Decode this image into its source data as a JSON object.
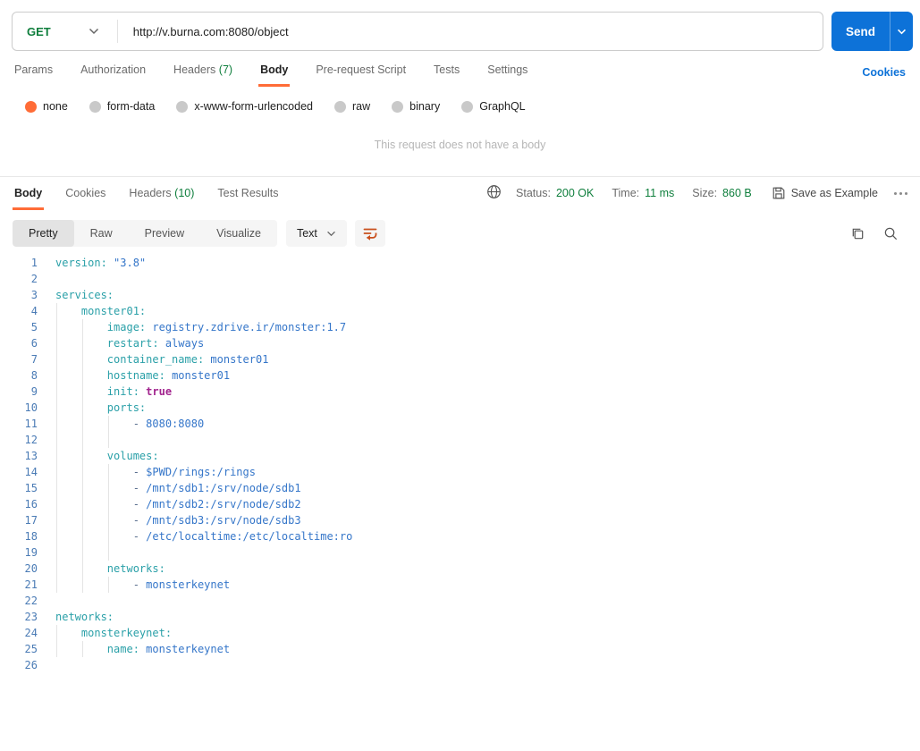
{
  "colors": {
    "orange": "#ff6c37",
    "green": "#0e7e3c",
    "blue": "#0d72d8",
    "key": "#2aa0a8",
    "val": "#3576c9",
    "dash": "#5a6f8f",
    "bool": "#a2248e",
    "lnum": "#4a7bb5",
    "guide": "#e4e4e4",
    "graytext": "#6b6b6b",
    "darktext": "#212121",
    "muted": "#b6b6b6"
  },
  "request_bar": {
    "method": "GET",
    "url": "http://v.burna.com:8080/object",
    "send_label": "Send"
  },
  "request_tabs": {
    "items": [
      {
        "label": "Params"
      },
      {
        "label": "Authorization"
      },
      {
        "label": "Headers",
        "count": "(7)"
      },
      {
        "label": "Body",
        "active": true
      },
      {
        "label": "Pre-request Script"
      },
      {
        "label": "Tests"
      },
      {
        "label": "Settings"
      }
    ],
    "cookies_link": "Cookies"
  },
  "body_modes": {
    "options": [
      "none",
      "form-data",
      "x-www-form-urlencoded",
      "raw",
      "binary",
      "GraphQL"
    ],
    "selected": "none",
    "empty_message": "This request does not have a body"
  },
  "response": {
    "tabs": [
      {
        "label": "Body",
        "active": true
      },
      {
        "label": "Cookies"
      },
      {
        "label": "Headers",
        "count": "(10)"
      },
      {
        "label": "Test Results"
      }
    ],
    "meta": {
      "status_label": "Status:",
      "status_value": "200 OK",
      "time_label": "Time:",
      "time_value": "11 ms",
      "size_label": "Size:",
      "size_value": "860 B",
      "save_as_example": "Save as Example"
    },
    "view_tabs": {
      "options": [
        "Pretty",
        "Raw",
        "Preview",
        "Visualize"
      ],
      "selected": "Pretty",
      "format": "Text"
    }
  },
  "code": {
    "lines": [
      {
        "n": 1,
        "g": [],
        "seg": [
          [
            "k",
            "version:"
          ],
          [
            "p",
            " "
          ],
          [
            "v",
            "\"3.8\""
          ]
        ]
      },
      {
        "n": 2,
        "g": [],
        "seg": []
      },
      {
        "n": 3,
        "g": [],
        "seg": [
          [
            "k",
            "services:"
          ]
        ]
      },
      {
        "n": 4,
        "g": [
          0
        ],
        "seg": [
          [
            "p",
            "    "
          ],
          [
            "k",
            "monster01:"
          ]
        ]
      },
      {
        "n": 5,
        "g": [
          0,
          4
        ],
        "seg": [
          [
            "p",
            "        "
          ],
          [
            "k",
            "image:"
          ],
          [
            "p",
            " "
          ],
          [
            "v",
            "registry.zdrive.ir/monster:1.7"
          ]
        ]
      },
      {
        "n": 6,
        "g": [
          0,
          4
        ],
        "seg": [
          [
            "p",
            "        "
          ],
          [
            "k",
            "restart:"
          ],
          [
            "p",
            " "
          ],
          [
            "v",
            "always"
          ]
        ]
      },
      {
        "n": 7,
        "g": [
          0,
          4
        ],
        "seg": [
          [
            "p",
            "        "
          ],
          [
            "k",
            "container_name:"
          ],
          [
            "p",
            " "
          ],
          [
            "v",
            "monster01"
          ]
        ]
      },
      {
        "n": 8,
        "g": [
          0,
          4
        ],
        "seg": [
          [
            "p",
            "        "
          ],
          [
            "k",
            "hostname:"
          ],
          [
            "p",
            " "
          ],
          [
            "v",
            "monster01"
          ]
        ]
      },
      {
        "n": 9,
        "g": [
          0,
          4
        ],
        "seg": [
          [
            "p",
            "        "
          ],
          [
            "k",
            "init:"
          ],
          [
            "p",
            " "
          ],
          [
            "b",
            "true"
          ]
        ]
      },
      {
        "n": 10,
        "g": [
          0,
          4
        ],
        "seg": [
          [
            "p",
            "        "
          ],
          [
            "k",
            "ports:"
          ]
        ]
      },
      {
        "n": 11,
        "g": [
          0,
          4,
          8
        ],
        "seg": [
          [
            "p",
            "            "
          ],
          [
            "d",
            "- "
          ],
          [
            "v",
            "8080:8080"
          ]
        ]
      },
      {
        "n": 12,
        "g": [
          0,
          4,
          8
        ],
        "seg": []
      },
      {
        "n": 13,
        "g": [
          0,
          4
        ],
        "seg": [
          [
            "p",
            "        "
          ],
          [
            "k",
            "volumes:"
          ]
        ]
      },
      {
        "n": 14,
        "g": [
          0,
          4,
          8
        ],
        "seg": [
          [
            "p",
            "            "
          ],
          [
            "d",
            "- "
          ],
          [
            "v",
            "$PWD/rings:/rings"
          ]
        ]
      },
      {
        "n": 15,
        "g": [
          0,
          4,
          8
        ],
        "seg": [
          [
            "p",
            "            "
          ],
          [
            "d",
            "- "
          ],
          [
            "v",
            "/mnt/sdb1:/srv/node/sdb1"
          ]
        ]
      },
      {
        "n": 16,
        "g": [
          0,
          4,
          8
        ],
        "seg": [
          [
            "p",
            "            "
          ],
          [
            "d",
            "- "
          ],
          [
            "v",
            "/mnt/sdb2:/srv/node/sdb2"
          ]
        ]
      },
      {
        "n": 17,
        "g": [
          0,
          4,
          8
        ],
        "seg": [
          [
            "p",
            "            "
          ],
          [
            "d",
            "- "
          ],
          [
            "v",
            "/mnt/sdb3:/srv/node/sdb3"
          ]
        ]
      },
      {
        "n": 18,
        "g": [
          0,
          4,
          8
        ],
        "seg": [
          [
            "p",
            "            "
          ],
          [
            "d",
            "- "
          ],
          [
            "v",
            "/etc/localtime:/etc/localtime:ro"
          ]
        ]
      },
      {
        "n": 19,
        "g": [
          0,
          4,
          8
        ],
        "seg": []
      },
      {
        "n": 20,
        "g": [
          0,
          4
        ],
        "seg": [
          [
            "p",
            "        "
          ],
          [
            "k",
            "networks:"
          ]
        ]
      },
      {
        "n": 21,
        "g": [
          0,
          4,
          8
        ],
        "seg": [
          [
            "p",
            "            "
          ],
          [
            "d",
            "- "
          ],
          [
            "v",
            "monsterkeynet"
          ]
        ]
      },
      {
        "n": 22,
        "g": [],
        "seg": []
      },
      {
        "n": 23,
        "g": [],
        "seg": [
          [
            "k",
            "networks:"
          ]
        ]
      },
      {
        "n": 24,
        "g": [
          0
        ],
        "seg": [
          [
            "p",
            "    "
          ],
          [
            "k",
            "monsterkeynet:"
          ]
        ]
      },
      {
        "n": 25,
        "g": [
          0,
          4
        ],
        "seg": [
          [
            "p",
            "        "
          ],
          [
            "k",
            "name:"
          ],
          [
            "p",
            " "
          ],
          [
            "v",
            "monsterkeynet"
          ]
        ]
      },
      {
        "n": 26,
        "g": [],
        "seg": []
      }
    ]
  }
}
